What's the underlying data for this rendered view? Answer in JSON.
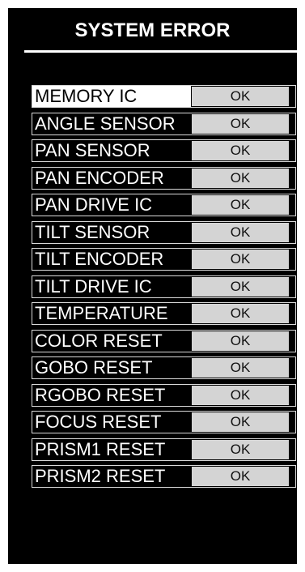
{
  "title": "SYSTEM ERROR",
  "items": [
    {
      "label": "MEMORY IC",
      "status": "OK"
    },
    {
      "label": "ANGLE SENSOR",
      "status": "OK"
    },
    {
      "label": "PAN SENSOR",
      "status": "OK"
    },
    {
      "label": "PAN ENCODER",
      "status": "OK"
    },
    {
      "label": "PAN DRIVE IC",
      "status": "OK"
    },
    {
      "label": "TILT SENSOR",
      "status": "OK"
    },
    {
      "label": "TILT ENCODER",
      "status": "OK"
    },
    {
      "label": "TILT DRIVE IC",
      "status": "OK"
    },
    {
      "label": "TEMPERATURE",
      "status": "OK"
    },
    {
      "label": "COLOR RESET",
      "status": "OK"
    },
    {
      "label": "GOBO RESET",
      "status": "OK"
    },
    {
      "label": "RGOBO RESET",
      "status": "OK"
    },
    {
      "label": "FOCUS RESET",
      "status": "OK"
    },
    {
      "label": "PRISM1 RESET",
      "status": "OK"
    },
    {
      "label": "PRISM2 RESET",
      "status": "OK"
    }
  ],
  "selected_index": 0,
  "colors": {
    "background": "#000000",
    "text": "#ffffff",
    "status_fill": "#d4d4d4",
    "highlight": "#ffffff"
  }
}
